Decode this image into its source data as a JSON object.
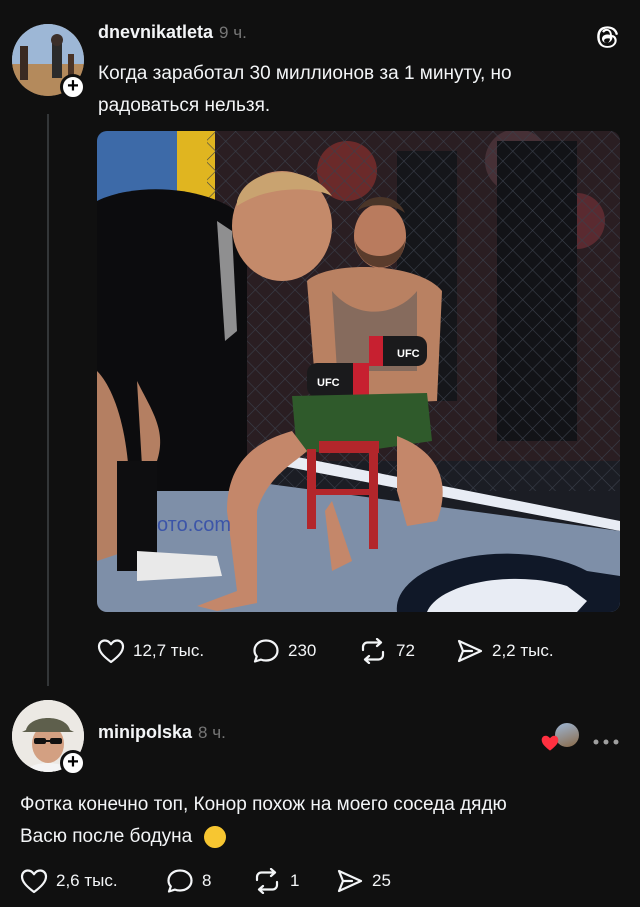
{
  "post": {
    "username": "dnevnikatleta",
    "time": "9 ч.",
    "text_line1": "Когда заработал 30 миллионов за 1 минуту, но",
    "text_line2": "радоваться нельзя.",
    "stats": {
      "likes": "12,7 тыс.",
      "comments": "230",
      "reposts": "72",
      "shares": "2,2 тыс."
    },
    "image_caption_fragments": {
      "ufc_glove_left": "UFC",
      "ufc_glove_right": "UFC",
      "floor_text": "ото.com"
    }
  },
  "reply": {
    "username": "minipolska",
    "time": "8 ч.",
    "text_line1": "Фотка конечно топ, Конор похож на моего соседа дядю",
    "text_line2": "Васю после бодуна",
    "emoji": "🤣",
    "stats": {
      "likes": "2,6 тыс.",
      "comments": "8",
      "reposts": "1",
      "shares": "25"
    }
  },
  "colors": {
    "background": "#101010",
    "text": "#f3f5f7",
    "muted": "#777777",
    "like_red": "#ff3040"
  },
  "icons": [
    "threads-logo-icon",
    "heart-icon",
    "comment-icon",
    "repost-icon",
    "share-icon",
    "more-icon"
  ]
}
